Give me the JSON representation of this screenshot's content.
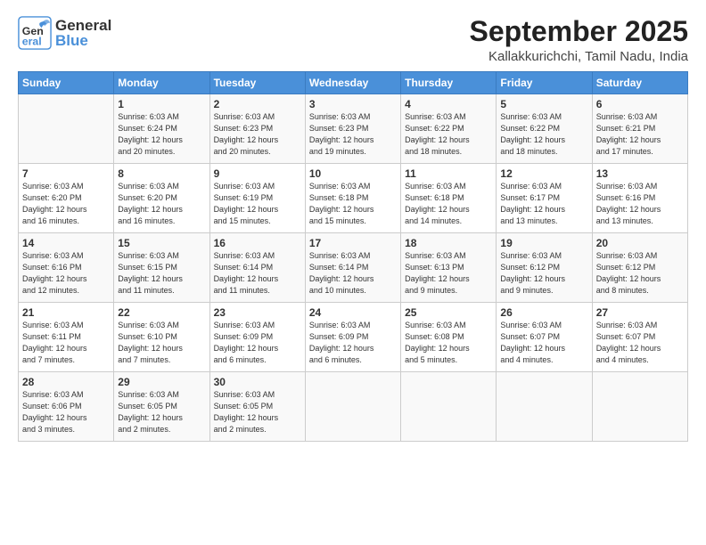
{
  "header": {
    "logo_general": "General",
    "logo_blue": "Blue",
    "month": "September 2025",
    "location": "Kallakkurichchi, Tamil Nadu, India"
  },
  "days_of_week": [
    "Sunday",
    "Monday",
    "Tuesday",
    "Wednesday",
    "Thursday",
    "Friday",
    "Saturday"
  ],
  "weeks": [
    [
      {
        "day": "",
        "info": ""
      },
      {
        "day": "1",
        "info": "Sunrise: 6:03 AM\nSunset: 6:24 PM\nDaylight: 12 hours\nand 20 minutes."
      },
      {
        "day": "2",
        "info": "Sunrise: 6:03 AM\nSunset: 6:23 PM\nDaylight: 12 hours\nand 20 minutes."
      },
      {
        "day": "3",
        "info": "Sunrise: 6:03 AM\nSunset: 6:23 PM\nDaylight: 12 hours\nand 19 minutes."
      },
      {
        "day": "4",
        "info": "Sunrise: 6:03 AM\nSunset: 6:22 PM\nDaylight: 12 hours\nand 18 minutes."
      },
      {
        "day": "5",
        "info": "Sunrise: 6:03 AM\nSunset: 6:22 PM\nDaylight: 12 hours\nand 18 minutes."
      },
      {
        "day": "6",
        "info": "Sunrise: 6:03 AM\nSunset: 6:21 PM\nDaylight: 12 hours\nand 17 minutes."
      }
    ],
    [
      {
        "day": "7",
        "info": "Sunrise: 6:03 AM\nSunset: 6:20 PM\nDaylight: 12 hours\nand 16 minutes."
      },
      {
        "day": "8",
        "info": "Sunrise: 6:03 AM\nSunset: 6:20 PM\nDaylight: 12 hours\nand 16 minutes."
      },
      {
        "day": "9",
        "info": "Sunrise: 6:03 AM\nSunset: 6:19 PM\nDaylight: 12 hours\nand 15 minutes."
      },
      {
        "day": "10",
        "info": "Sunrise: 6:03 AM\nSunset: 6:18 PM\nDaylight: 12 hours\nand 15 minutes."
      },
      {
        "day": "11",
        "info": "Sunrise: 6:03 AM\nSunset: 6:18 PM\nDaylight: 12 hours\nand 14 minutes."
      },
      {
        "day": "12",
        "info": "Sunrise: 6:03 AM\nSunset: 6:17 PM\nDaylight: 12 hours\nand 13 minutes."
      },
      {
        "day": "13",
        "info": "Sunrise: 6:03 AM\nSunset: 6:16 PM\nDaylight: 12 hours\nand 13 minutes."
      }
    ],
    [
      {
        "day": "14",
        "info": "Sunrise: 6:03 AM\nSunset: 6:16 PM\nDaylight: 12 hours\nand 12 minutes."
      },
      {
        "day": "15",
        "info": "Sunrise: 6:03 AM\nSunset: 6:15 PM\nDaylight: 12 hours\nand 11 minutes."
      },
      {
        "day": "16",
        "info": "Sunrise: 6:03 AM\nSunset: 6:14 PM\nDaylight: 12 hours\nand 11 minutes."
      },
      {
        "day": "17",
        "info": "Sunrise: 6:03 AM\nSunset: 6:14 PM\nDaylight: 12 hours\nand 10 minutes."
      },
      {
        "day": "18",
        "info": "Sunrise: 6:03 AM\nSunset: 6:13 PM\nDaylight: 12 hours\nand 9 minutes."
      },
      {
        "day": "19",
        "info": "Sunrise: 6:03 AM\nSunset: 6:12 PM\nDaylight: 12 hours\nand 9 minutes."
      },
      {
        "day": "20",
        "info": "Sunrise: 6:03 AM\nSunset: 6:12 PM\nDaylight: 12 hours\nand 8 minutes."
      }
    ],
    [
      {
        "day": "21",
        "info": "Sunrise: 6:03 AM\nSunset: 6:11 PM\nDaylight: 12 hours\nand 7 minutes."
      },
      {
        "day": "22",
        "info": "Sunrise: 6:03 AM\nSunset: 6:10 PM\nDaylight: 12 hours\nand 7 minutes."
      },
      {
        "day": "23",
        "info": "Sunrise: 6:03 AM\nSunset: 6:09 PM\nDaylight: 12 hours\nand 6 minutes."
      },
      {
        "day": "24",
        "info": "Sunrise: 6:03 AM\nSunset: 6:09 PM\nDaylight: 12 hours\nand 6 minutes."
      },
      {
        "day": "25",
        "info": "Sunrise: 6:03 AM\nSunset: 6:08 PM\nDaylight: 12 hours\nand 5 minutes."
      },
      {
        "day": "26",
        "info": "Sunrise: 6:03 AM\nSunset: 6:07 PM\nDaylight: 12 hours\nand 4 minutes."
      },
      {
        "day": "27",
        "info": "Sunrise: 6:03 AM\nSunset: 6:07 PM\nDaylight: 12 hours\nand 4 minutes."
      }
    ],
    [
      {
        "day": "28",
        "info": "Sunrise: 6:03 AM\nSunset: 6:06 PM\nDaylight: 12 hours\nand 3 minutes."
      },
      {
        "day": "29",
        "info": "Sunrise: 6:03 AM\nSunset: 6:05 PM\nDaylight: 12 hours\nand 2 minutes."
      },
      {
        "day": "30",
        "info": "Sunrise: 6:03 AM\nSunset: 6:05 PM\nDaylight: 12 hours\nand 2 minutes."
      },
      {
        "day": "",
        "info": ""
      },
      {
        "day": "",
        "info": ""
      },
      {
        "day": "",
        "info": ""
      },
      {
        "day": "",
        "info": ""
      }
    ]
  ]
}
